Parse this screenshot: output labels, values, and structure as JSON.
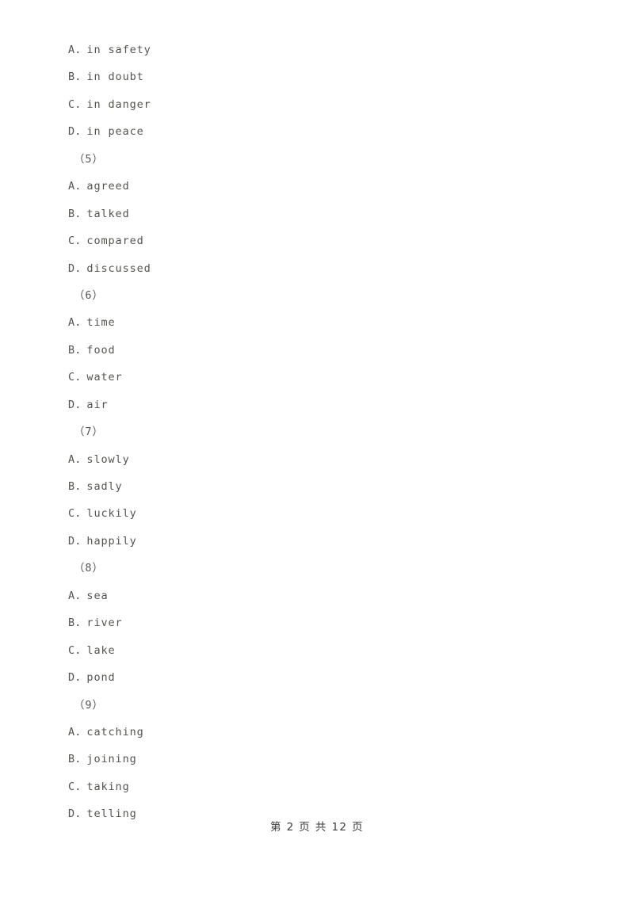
{
  "document": {
    "page_background": "#ffffff",
    "text_color": "#54544f",
    "footer_color": "#3b3b38",
    "lines": [
      {
        "kind": "option",
        "text": "A．in safety"
      },
      {
        "kind": "option",
        "text": "B．in doubt"
      },
      {
        "kind": "option",
        "text": "C．in danger"
      },
      {
        "kind": "option",
        "text": "D．in peace"
      },
      {
        "kind": "qnum",
        "text": "（5）"
      },
      {
        "kind": "option",
        "text": "A．agreed"
      },
      {
        "kind": "option",
        "text": "B．talked"
      },
      {
        "kind": "option",
        "text": "C．compared"
      },
      {
        "kind": "option",
        "text": "D．discussed"
      },
      {
        "kind": "qnum",
        "text": "（6）"
      },
      {
        "kind": "option",
        "text": "A．time"
      },
      {
        "kind": "option",
        "text": "B．food"
      },
      {
        "kind": "option",
        "text": "C．water"
      },
      {
        "kind": "option",
        "text": "D．air"
      },
      {
        "kind": "qnum",
        "text": "（7）"
      },
      {
        "kind": "option",
        "text": "A．slowly"
      },
      {
        "kind": "option",
        "text": "B．sadly"
      },
      {
        "kind": "option",
        "text": "C．luckily"
      },
      {
        "kind": "option",
        "text": "D．happily"
      },
      {
        "kind": "qnum",
        "text": "（8）"
      },
      {
        "kind": "option",
        "text": "A．sea"
      },
      {
        "kind": "option",
        "text": "B．river"
      },
      {
        "kind": "option",
        "text": "C．lake"
      },
      {
        "kind": "option",
        "text": "D．pond"
      },
      {
        "kind": "qnum",
        "text": "（9）"
      },
      {
        "kind": "option",
        "text": "A．catching"
      },
      {
        "kind": "option",
        "text": "B．joining"
      },
      {
        "kind": "option",
        "text": "C．taking"
      },
      {
        "kind": "option",
        "text": "D．telling"
      }
    ]
  },
  "footer": {
    "text": "第 2 页 共 12 页",
    "current_page": "2",
    "total_pages": "12"
  }
}
